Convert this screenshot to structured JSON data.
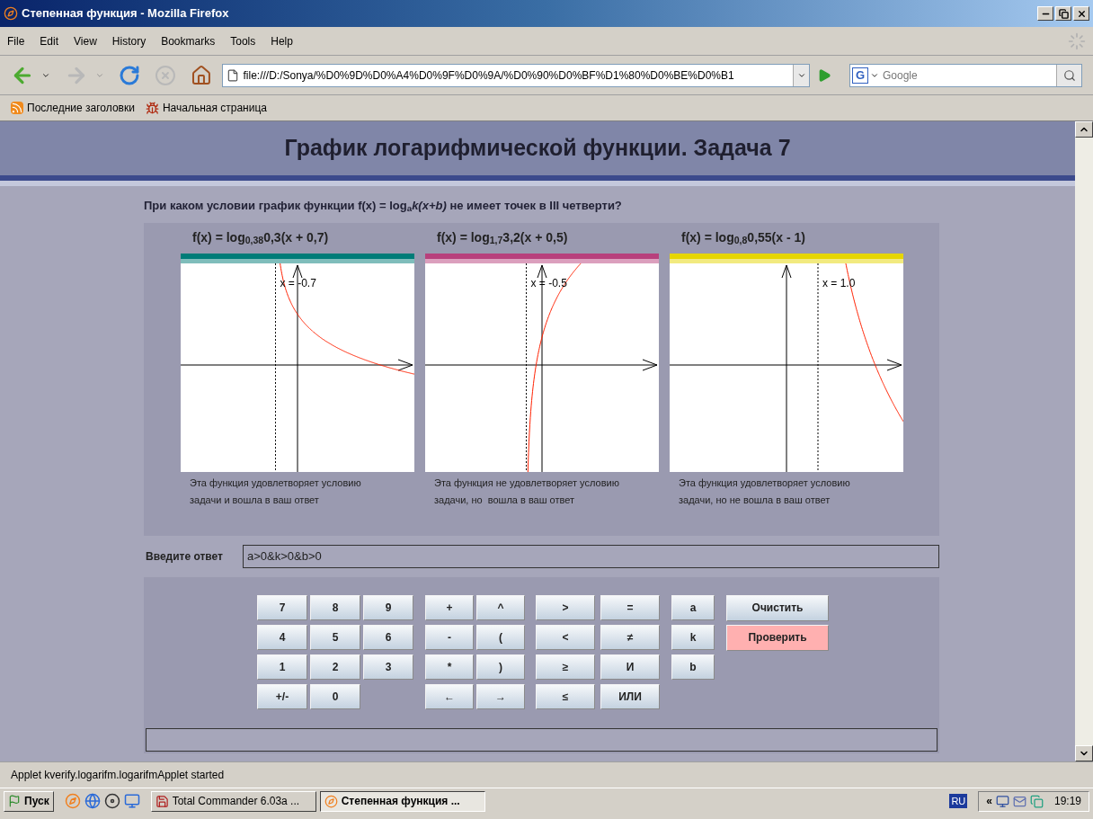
{
  "window": {
    "title": "Степенная функция - Mozilla Firefox"
  },
  "menu": [
    "File",
    "Edit",
    "View",
    "History",
    "Bookmarks",
    "Tools",
    "Help"
  ],
  "toolbar": {
    "url": "file:///D:/Sonya/%D0%9D%D0%A4%D0%9F%D0%9A/%D0%90%D0%BF%D1%80%D0%BE%D0%B1",
    "search_logo": "G",
    "search_placeholder": "Google"
  },
  "bookmarks": [
    {
      "label": "Последние заголовки",
      "kind": "feed"
    },
    {
      "label": "Начальная страница",
      "kind": "page"
    }
  ],
  "page": {
    "title": "График логарифмической функции. Задача 7",
    "question": "При каком условии график функции f(x) = log$_{a}$*k(x+b)* не имеет точек в III четверти?",
    "graphs": [
      {
        "formula": "f(x) = log$_{0,38}$0,3(x + 0,7)",
        "color": "#007c78",
        "asymptote_label": "x = -0.7",
        "caption": [
          "Эта функция удовлетворяет условию",
          "задачи и вошла в ваш ответ"
        ]
      },
      {
        "formula": "f(x) = log$_{1,7}$3,2(x + 0,5)",
        "color": "#b8407c",
        "asymptote_label": "x = -0.5",
        "caption": [
          "Эта функция не удовлетворяет условию",
          "задачи, но  вошла в ваш ответ"
        ]
      },
      {
        "formula": "f(x) = log$_{0,8}$0,55(x - 1)",
        "color": "#e6d600",
        "asymptote_label": "x = 1.0",
        "caption": [
          "Эта функция удовлетворяет условию",
          "задачи, но не вошла в ваш ответ"
        ]
      }
    ],
    "answer": {
      "label": "Введите ответ",
      "value": "a>0&k>0&b>0"
    },
    "keypad": [
      {
        "kind": "digits",
        "keys": [
          "7",
          "8",
          "9",
          "4",
          "5",
          "6",
          "1",
          "2",
          "3",
          "+/-",
          "0"
        ]
      },
      {
        "kind": "operators",
        "keys": [
          "+",
          "^",
          "-",
          "(",
          "*",
          ")",
          "←",
          "→"
        ]
      },
      {
        "kind": "comparisons",
        "keys": [
          ">",
          "=",
          "<",
          "≠",
          "≥",
          "И",
          "≤",
          "ИЛИ"
        ]
      },
      {
        "kind": "variables",
        "keys": [
          "a",
          "k",
          "b"
        ]
      }
    ],
    "actions": [
      {
        "label": "Очистить",
        "highlighted": false
      },
      {
        "label": "Проверить",
        "highlighted": true
      }
    ]
  },
  "status_bar": "Applet kverify.logarifm.logarifmApplet started",
  "taskbar": {
    "start": "Пуск",
    "tasks": [
      {
        "label": "Total Commander 6.03a ...",
        "selected": false
      },
      {
        "label": "Степенная функция ...",
        "selected": true
      }
    ],
    "language": "RU",
    "tray_expand": "«",
    "clock": "19:19"
  }
}
